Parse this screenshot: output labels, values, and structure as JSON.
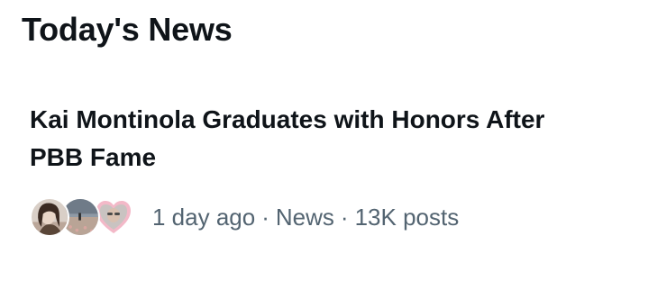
{
  "section": {
    "title": "Today's News"
  },
  "news_item": {
    "headline": "Kai Montinola Graduates with Honors After PBB Fame",
    "meta": {
      "time_ago": "1 day ago",
      "category": "News",
      "post_count": "13K posts",
      "separator": "·"
    },
    "avatars": [
      {
        "icon": "user-avatar-photo"
      },
      {
        "icon": "landscape-avatar-photo"
      },
      {
        "icon": "heart-frame-avatar-photo"
      }
    ]
  }
}
